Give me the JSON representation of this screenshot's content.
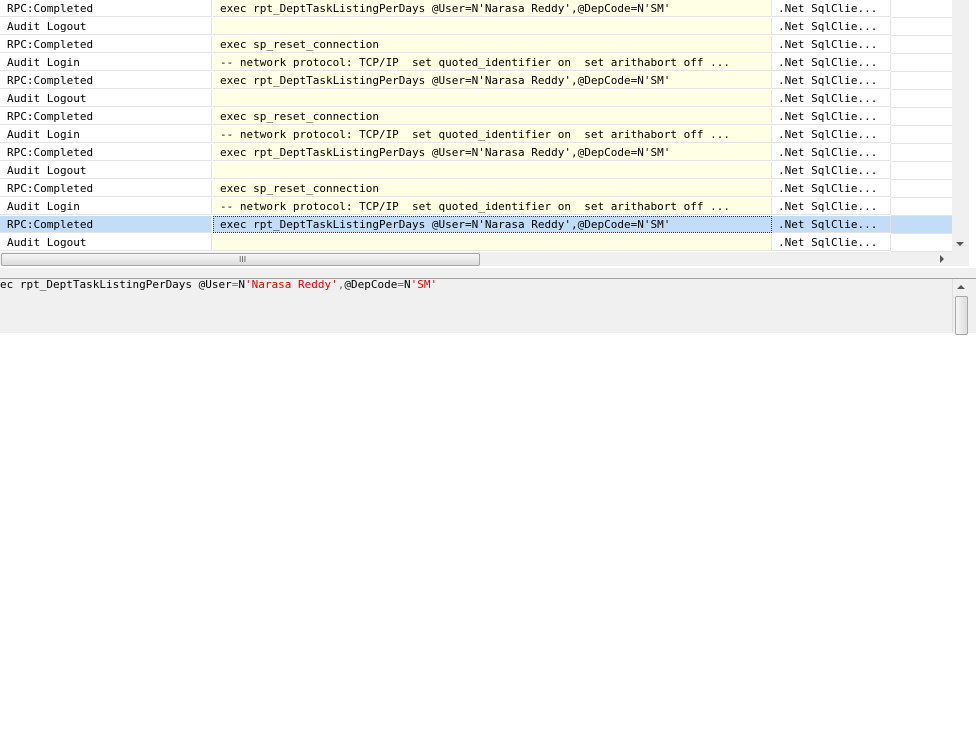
{
  "trace_grid": {
    "rows": [
      {
        "event": "RPC:Completed",
        "text": "exec rpt_DeptTaskListingPerDays @User=N'Narasa Reddy',@DepCode=N'SM'",
        "app": ".Net SqlClie..."
      },
      {
        "event": "Audit Logout",
        "text": "",
        "app": ".Net SqlClie..."
      },
      {
        "event": "RPC:Completed",
        "text": "exec sp_reset_connection",
        "app": ".Net SqlClie..."
      },
      {
        "event": "Audit Login",
        "text": "-- network protocol: TCP/IP  set quoted_identifier on  set arithabort off ...",
        "app": ".Net SqlClie..."
      },
      {
        "event": "RPC:Completed",
        "text": "exec rpt_DeptTaskListingPerDays @User=N'Narasa Reddy',@DepCode=N'SM'",
        "app": ".Net SqlClie..."
      },
      {
        "event": "Audit Logout",
        "text": "",
        "app": ".Net SqlClie..."
      },
      {
        "event": "RPC:Completed",
        "text": "exec sp_reset_connection",
        "app": ".Net SqlClie..."
      },
      {
        "event": "Audit Login",
        "text": "-- network protocol: TCP/IP  set quoted_identifier on  set arithabort off ...",
        "app": ".Net SqlClie..."
      },
      {
        "event": "RPC:Completed",
        "text": "exec rpt_DeptTaskListingPerDays @User=N'Narasa Reddy',@DepCode=N'SM'",
        "app": ".Net SqlClie..."
      },
      {
        "event": "Audit Logout",
        "text": "",
        "app": ".Net SqlClie..."
      },
      {
        "event": "RPC:Completed",
        "text": "exec sp_reset_connection",
        "app": ".Net SqlClie..."
      },
      {
        "event": "Audit Login",
        "text": "-- network protocol: TCP/IP  set quoted_identifier on  set arithabort off ...",
        "app": ".Net SqlClie..."
      },
      {
        "event": "RPC:Completed",
        "text": "exec rpt_DeptTaskListingPerDays @User=N'Narasa Reddy',@DepCode=N'SM'",
        "app": ".Net SqlClie...",
        "selected": true
      },
      {
        "event": "Audit Logout",
        "text": "",
        "app": ".Net SqlClie..."
      }
    ]
  },
  "hscroll": {
    "grip_glyph": "III"
  },
  "detail": {
    "t1": "ec rpt_DeptTaskListingPerDays @User",
    "t2": "=",
    "t3": "N",
    "t4": "'Narasa Reddy'",
    "t5": ",",
    "t6": "@DepCode",
    "t7": "=",
    "t8": "N",
    "t9": "'SM'"
  },
  "colors": {
    "text_column_bg": "#ffffe6",
    "selected_row_bg": "#c3dcf7",
    "string_literal": "#e00000"
  }
}
